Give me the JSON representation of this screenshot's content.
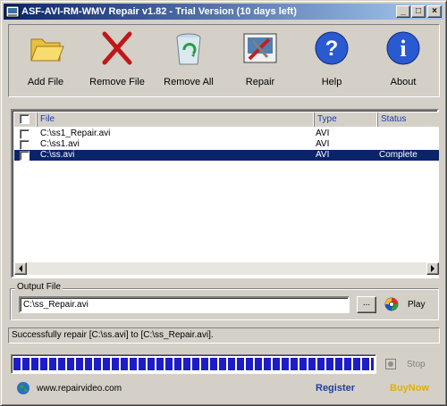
{
  "window": {
    "title": "ASF-AVI-RM-WMV Repair v1.82 - Trial Version (10 days left)",
    "buttons": {
      "minimize": "_",
      "maximize": "□",
      "close": "×"
    }
  },
  "toolbar": {
    "add_file": "Add File",
    "remove_file": "Remove File",
    "remove_all": "Remove All",
    "repair": "Repair",
    "help": "Help",
    "about": "About"
  },
  "file_list": {
    "columns": {
      "file": "File",
      "type": "Type",
      "status": "Status"
    },
    "rows": [
      {
        "file": "C:\\ss1_Repair.avi",
        "type": "AVI",
        "status": ""
      },
      {
        "file": "C:\\ss1.avi",
        "type": "AVI",
        "status": ""
      },
      {
        "file": "C:\\ss.avi",
        "type": "AVI",
        "status": "Complete"
      }
    ],
    "selected_row": 2
  },
  "output": {
    "label": "Output File",
    "value": "C:\\ss_Repair.avi",
    "browse_label": "...",
    "play_label": "Play"
  },
  "status_text": "Successfully repair [C:\\ss.avi] to [C:\\ss_Repair.avi].",
  "progress": {
    "percent": 100,
    "stop_label": "Stop"
  },
  "footer": {
    "website": "www.repairvideo.com",
    "register": "Register",
    "buynow": "BuyNow"
  },
  "colors": {
    "title_bar": "#0a246a",
    "selection": "#0a246a",
    "progress": "#1c1cc8",
    "register": "#2040a0",
    "buynow": "#e0b000"
  },
  "icons": {
    "add_file": "open-folder-icon",
    "remove_file": "red-x-icon",
    "remove_all": "recycle-bin-icon",
    "repair": "repair-tools-icon",
    "help": "question-mark-icon",
    "about": "info-icon",
    "play": "play-icon",
    "stop": "stop-icon",
    "website": "globe-icon"
  }
}
